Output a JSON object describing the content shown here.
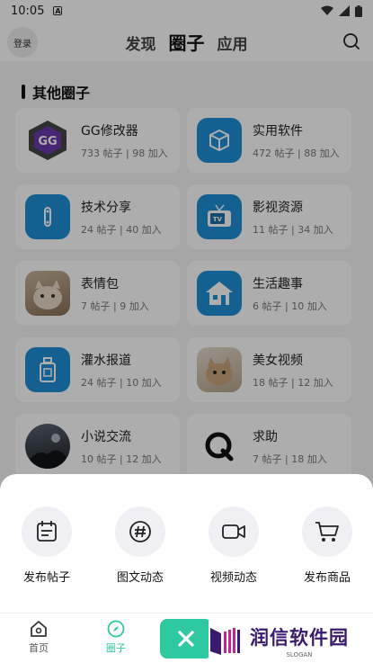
{
  "status": {
    "time": "10:05"
  },
  "header": {
    "login_label": "登录",
    "tabs": [
      {
        "label": "发现"
      },
      {
        "label": "圈子"
      },
      {
        "label": "应用"
      }
    ]
  },
  "section": {
    "title": "其他圈子"
  },
  "circles": [
    {
      "name": "GG修改器",
      "meta": "733 帖子 | 98 加入",
      "icon": "gg-logo-icon",
      "color": "#5a2e8a"
    },
    {
      "name": "实用软件",
      "meta": "472 帖子 | 88 加入",
      "icon": "cube-icon",
      "color": "#1e8fd6"
    },
    {
      "name": "技术分享",
      "meta": "24 帖子 | 40 加入",
      "icon": "wrench-icon",
      "color": "#1e8fd6"
    },
    {
      "name": "影视资源",
      "meta": "11 帖子 | 34 加入",
      "icon": "tv-icon",
      "color": "#1e8fd6"
    },
    {
      "name": "表情包",
      "meta": "7 帖子 | 9 加入",
      "icon": "cat-photo-icon",
      "color": "#b89a7a"
    },
    {
      "name": "生活趣事",
      "meta": "6 帖子 | 10 加入",
      "icon": "house-icon",
      "color": "#1e8fd6"
    },
    {
      "name": "灌水报道",
      "meta": "24 帖子 | 10 加入",
      "icon": "bottle-icon",
      "color": "#1e8fd6"
    },
    {
      "name": "美女视频",
      "meta": "18 帖子 | 12 加入",
      "icon": "cat-photo-icon",
      "color": "#d4c6b6"
    },
    {
      "name": "小说交流",
      "meta": "10 帖子 | 12 加入",
      "icon": "dark-scene-icon",
      "color": "#2a2f36"
    },
    {
      "name": "求助",
      "meta": "7 帖子 | 18 加入",
      "icon": "q-letter-icon",
      "color": "#ffffff"
    }
  ],
  "actions": [
    {
      "label": "发布帖子",
      "icon": "calendar-post-icon"
    },
    {
      "label": "图文动态",
      "icon": "hashtag-icon"
    },
    {
      "label": "视频动态",
      "icon": "video-camera-icon"
    },
    {
      "label": "发布商品",
      "icon": "shopping-cart-icon"
    }
  ],
  "nav": [
    {
      "label": "首页",
      "icon": "home-icon"
    },
    {
      "label": "圈子",
      "icon": "compass-icon"
    }
  ],
  "watermark": {
    "title": "润信软件园",
    "subtitle": "SLOGAN"
  },
  "colors": {
    "accent": "#2ec9a0",
    "brand_purple": "#3a1a6e"
  }
}
